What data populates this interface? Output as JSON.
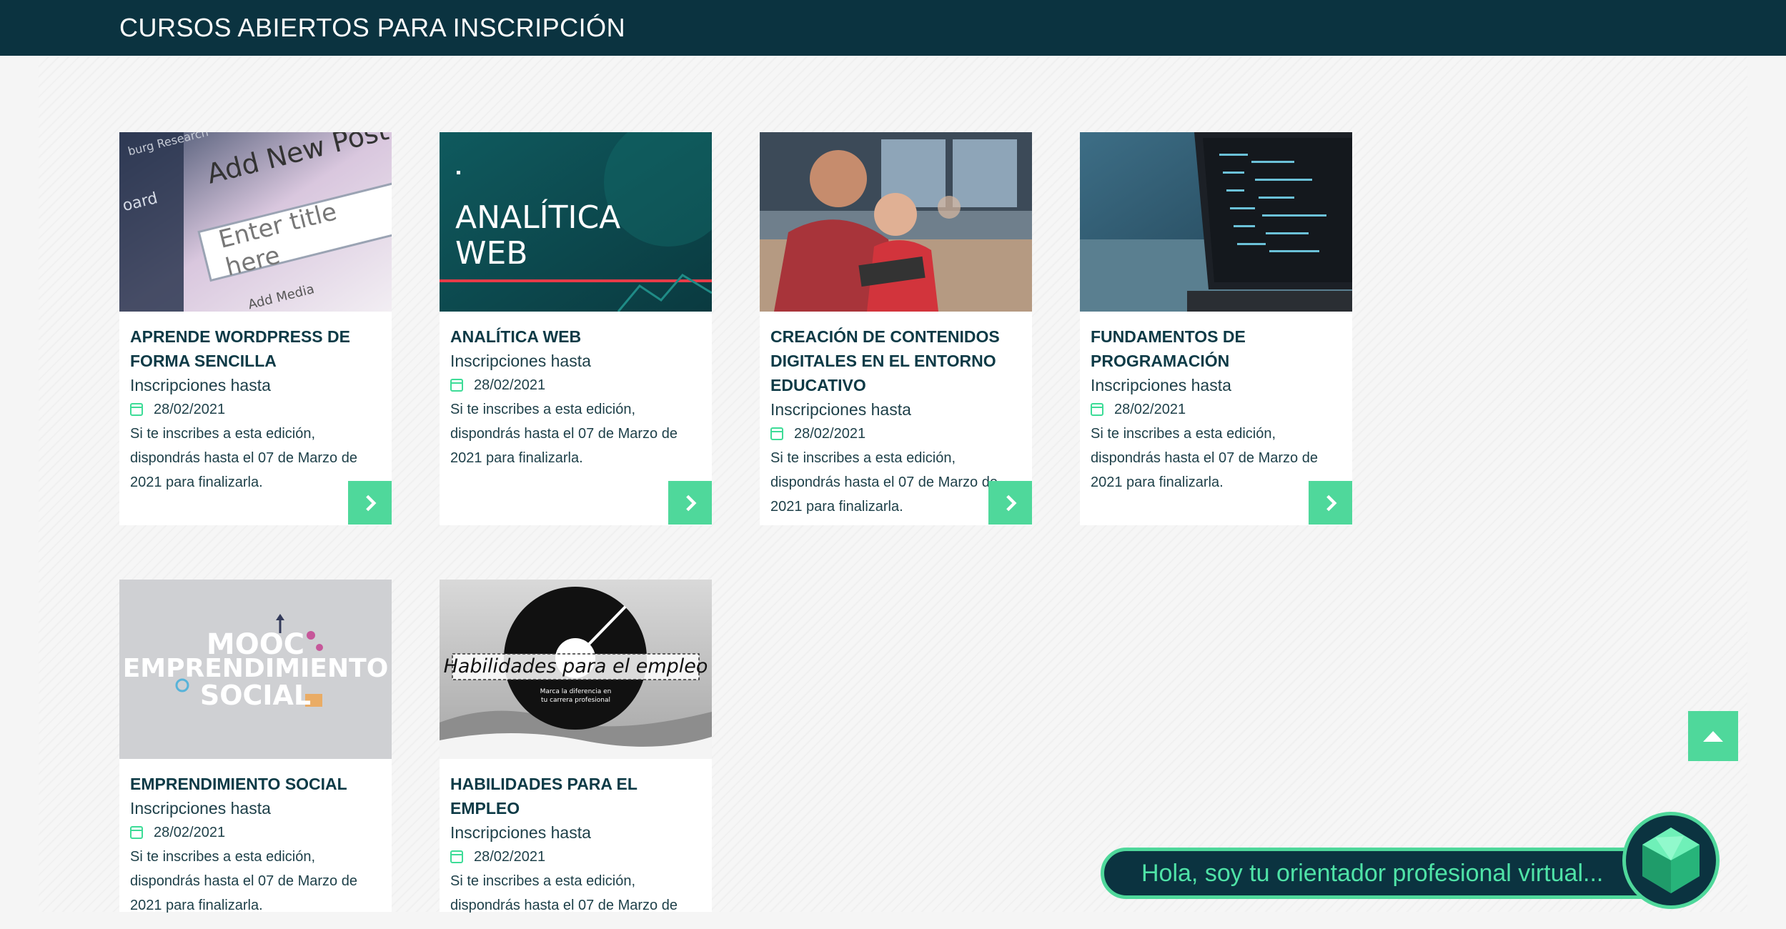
{
  "header": {
    "title": "CURSOS ABIERTOS PARA INSCRIPCIÓN"
  },
  "courses": [
    {
      "title": "APRENDE WORDPRESS DE FORMA SENCILLA",
      "label": "Inscripciones hasta",
      "date": "28/02/2021",
      "desc": "Si te inscribes a esta edición, dispondrás hasta el 07 de Marzo de 2021 para finalizarla.",
      "image_text": [
        "Add New Post",
        "Enter title here",
        "Add Media",
        "oard",
        "burg Research"
      ]
    },
    {
      "title": "ANALÍTICA WEB",
      "label": "Inscripciones hasta",
      "date": "28/02/2021",
      "desc": "Si te inscribes a esta edición, dispondrás hasta el 07 de Marzo de 2021 para finalizarla.",
      "image_text": [
        "ANALÍTICA",
        "WEB"
      ]
    },
    {
      "title": "CREACIÓN DE CONTENIDOS DIGITALES EN EL ENTORNO EDUCATIVO",
      "label": "Inscripciones hasta",
      "date": "28/02/2021",
      "desc": "Si te inscribes a esta edición, dispondrás hasta el 07 de Marzo de 2021 para finalizarla.",
      "image_text": []
    },
    {
      "title": "FUNDAMENTOS DE PROGRAMACIÓN",
      "label": "Inscripciones hasta",
      "date": "28/02/2021",
      "desc": "Si te inscribes a esta edición, dispondrás hasta el 07 de Marzo de 2021 para finalizarla.",
      "image_text": []
    },
    {
      "title": "EMPRENDIMIENTO SOCIAL",
      "label": "Inscripciones hasta",
      "date": "28/02/2021",
      "desc": "Si te inscribes a esta edición, dispondrás hasta el 07 de Marzo de 2021 para finalizarla.",
      "image_text": [
        "MOOC",
        "EMPRENDIMIENTO",
        "SOCIAL"
      ]
    },
    {
      "title": "HABILIDADES PARA EL EMPLEO",
      "label": "Inscripciones hasta",
      "date": "28/02/2021",
      "desc": "Si te inscribes a esta edición, dispondrás hasta el 07 de Marzo de",
      "image_text": [
        "Habilidades para el empleo",
        "Marca la diferencia en",
        "tu carrera profesional"
      ]
    }
  ],
  "chat": {
    "message": "Hola, soy tu orientador profesional virtual..."
  },
  "colors": {
    "header_bg": "#0b3340",
    "accent": "#4fd89b",
    "title_text": "#0d3a46"
  }
}
